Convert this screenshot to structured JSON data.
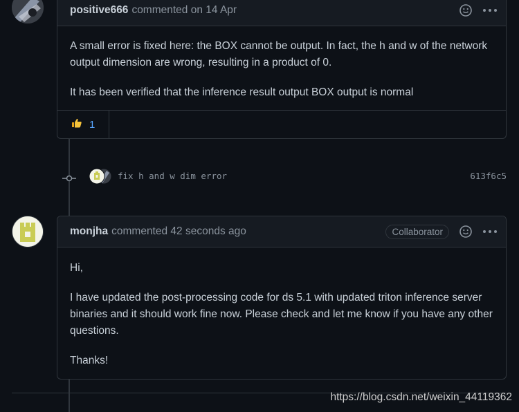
{
  "comment1": {
    "author": "positive666",
    "meta": "commented on 14 Apr",
    "paragraphs": [
      "A small error is fixed here: the BOX cannot be output. In fact, the h and w of the network output dimension are wrong, resulting in a product of 0.",
      "It has been verified that the inference result output BOX output is normal"
    ],
    "reaction": {
      "icon": "thumbs-up-icon",
      "count": "1"
    }
  },
  "commit": {
    "message": "fix h and w dim error",
    "sha": "613f6c5"
  },
  "comment2": {
    "author": "monjha",
    "meta": "commented 42 seconds ago",
    "badge": "Collaborator",
    "paragraphs": [
      "Hi,",
      "I have updated the post-processing code for ds 5.1 with updated triton inference server binaries and it should work fine now. Please check and let me know if you have any other questions.",
      "Thanks!"
    ]
  },
  "icons": {
    "emoji": "smiley-icon",
    "menu": "kebab-icon"
  },
  "colors": {
    "background": "#0d1117",
    "header": "#161b22",
    "border": "#30363d",
    "link": "#58a6ff"
  },
  "watermark": "https://blog.csdn.net/weixin_44119362"
}
